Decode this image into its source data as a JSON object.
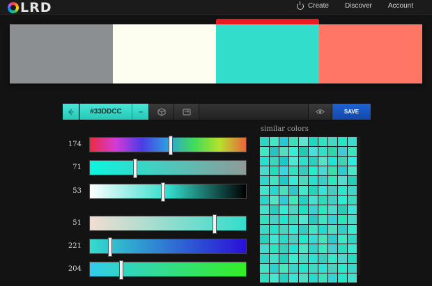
{
  "brand": {
    "logo_text": "LRD",
    "logo_initial": "C"
  },
  "nav": [
    {
      "label": "Create",
      "icon": "power-icon"
    },
    {
      "label": "Discover"
    },
    {
      "label": "Account"
    }
  ],
  "palette": {
    "selected_index": 2,
    "swatches": [
      {
        "color": "#8c8f92",
        "width": 148
      },
      {
        "color": "#fdfeef",
        "width": 148
      },
      {
        "color": "#33ddcc",
        "width": 148
      },
      {
        "color": "#ff7664",
        "width": 148
      }
    ]
  },
  "toolbar": {
    "hex": "#33DDCC",
    "prev_icon": "arrow-left-icon",
    "minus_icon": "minus-icon",
    "shuffle_icon": "cube-icon",
    "swap_icon": "swap-icon",
    "view_icon": "eye-icon",
    "save_label": "SAVE"
  },
  "sliders": [
    {
      "label": "174",
      "fraction": 0.52,
      "gradient": "linear-gradient(90deg,#ec2b3f,#d43bd8,#4b3be6,#2e9fe0,#3fdc5a,#b8e02b,#e8663a)"
    },
    {
      "label": "71",
      "fraction": 0.29,
      "gradient": "linear-gradient(90deg,#0cf5e0,#8f9a98)"
    },
    {
      "label": "53",
      "fraction": 0.47,
      "gradient": "linear-gradient(90deg,#ffffff,#33ddcc 50%,#000000)"
    },
    {
      "label": "51",
      "fraction": 0.8,
      "gradient": "linear-gradient(90deg,#f3ddd0,#33ddcc)"
    },
    {
      "label": "221",
      "fraction": 0.13,
      "gradient": "linear-gradient(90deg,#33ddcc,#2a0fd8)"
    },
    {
      "label": "204",
      "fraction": 0.2,
      "gradient": "linear-gradient(90deg,#33ccee,#33ee22)"
    }
  ],
  "similar": {
    "title": "similar colors",
    "colors": [
      "#2cd5c4",
      "#44e6c8",
      "#28c9d6",
      "#3ce0b6",
      "#5fe3d6",
      "#1fd8c0",
      "#30e2c2",
      "#44d8c6",
      "#22e8c5",
      "#3bdcd2",
      "#3fe8c4",
      "#27c3c3",
      "#54ddbf",
      "#34eed6",
      "#21cbb3",
      "#46e0de",
      "#32dfc8",
      "#2bd8aa",
      "#41cbd8",
      "#3ae6bd",
      "#26e0cf",
      "#39d6be",
      "#1bc9c9",
      "#4ae9d3",
      "#33ddcc",
      "#2ad1c0",
      "#55e2c8",
      "#1de6d6",
      "#40d3b4",
      "#30ece0",
      "#48dbcd",
      "#22ddb9",
      "#3dd3e0",
      "#2fe3bf",
      "#38c9c1",
      "#24eec9",
      "#4ad8d6",
      "#35e0ad",
      "#2ccdd0",
      "#49e6c7",
      "#2fd6cc",
      "#43e3c1",
      "#20cbc7",
      "#37ead8",
      "#4cd9b9",
      "#28e0cf",
      "#3acfc6",
      "#2be9be",
      "#52dbd0",
      "#24cfb8",
      "#3ce5cc",
      "#25d9d2",
      "#4be0bd",
      "#2ec8cc",
      "#40eac9",
      "#1fd7bb",
      "#36e4d7",
      "#46ccbe",
      "#29e6cc",
      "#3dd6c8",
      "#2ad6c9",
      "#50e5c5",
      "#30cbd6",
      "#3ee8b7",
      "#23d2c4",
      "#48e0d2",
      "#2cdcb9",
      "#3fd0ca",
      "#26edd3",
      "#37d9c0",
      "#42e1cb",
      "#29cdbd",
      "#35ebd3",
      "#4ad5c5",
      "#1ee1c4",
      "#3bd2d5",
      "#2ce8c0",
      "#47dccd",
      "#25cfb6",
      "#3ae4d8",
      "#2fe0c1",
      "#45d3c9",
      "#22e4cf",
      "#3ad8bc",
      "#4fe6d1",
      "#2ac9c4",
      "#3ee2c5",
      "#33d1d8",
      "#27e7bb",
      "#44dccd",
      "#39d9c7",
      "#26e3cb",
      "#48d4bd",
      "#2fe9d4",
      "#34cdc3",
      "#41e5c2",
      "#23d9d0",
      "#4cdfbf",
      "#2ed0c8",
      "#38ecd1",
      "#26d3bf",
      "#3fe6d3",
      "#2ddac6",
      "#4ad0c2",
      "#22e8cc",
      "#37dcd6",
      "#44e3bb",
      "#2bcdcf",
      "#3de8c6",
      "#30d6c4",
      "#43dbd0",
      "#28e6c2",
      "#36d0bc",
      "#21e2d4",
      "#4ce4c6",
      "#2fd5ca",
      "#3ae7c0",
      "#45cfd2",
      "#27dfbd",
      "#35e8cf",
      "#2dd7c7",
      "#41e0cb",
      "#24d1bd",
      "#3beacf",
      "#47d8c5",
      "#2ae3d2",
      "#39cebf",
      "#30e9c8",
      "#4ad5cf",
      "#25dcc0",
      "#3fe4c7",
      "#2cd2d0",
      "#45e8be",
      "#36d4c9",
      "#23e5cd",
      "#3dd9c2",
      "#2fe2d6",
      "#49d0bf",
      "#28e9c9",
      "#37d7cc",
      "#31dcc3",
      "#46e6cf",
      "#27cfc1",
      "#3ce3d3",
      "#4fdcc4",
      "#2ad9cc",
      "#3be0bc",
      "#34d3d4",
      "#22e6c6",
      "#42dec9"
    ]
  }
}
